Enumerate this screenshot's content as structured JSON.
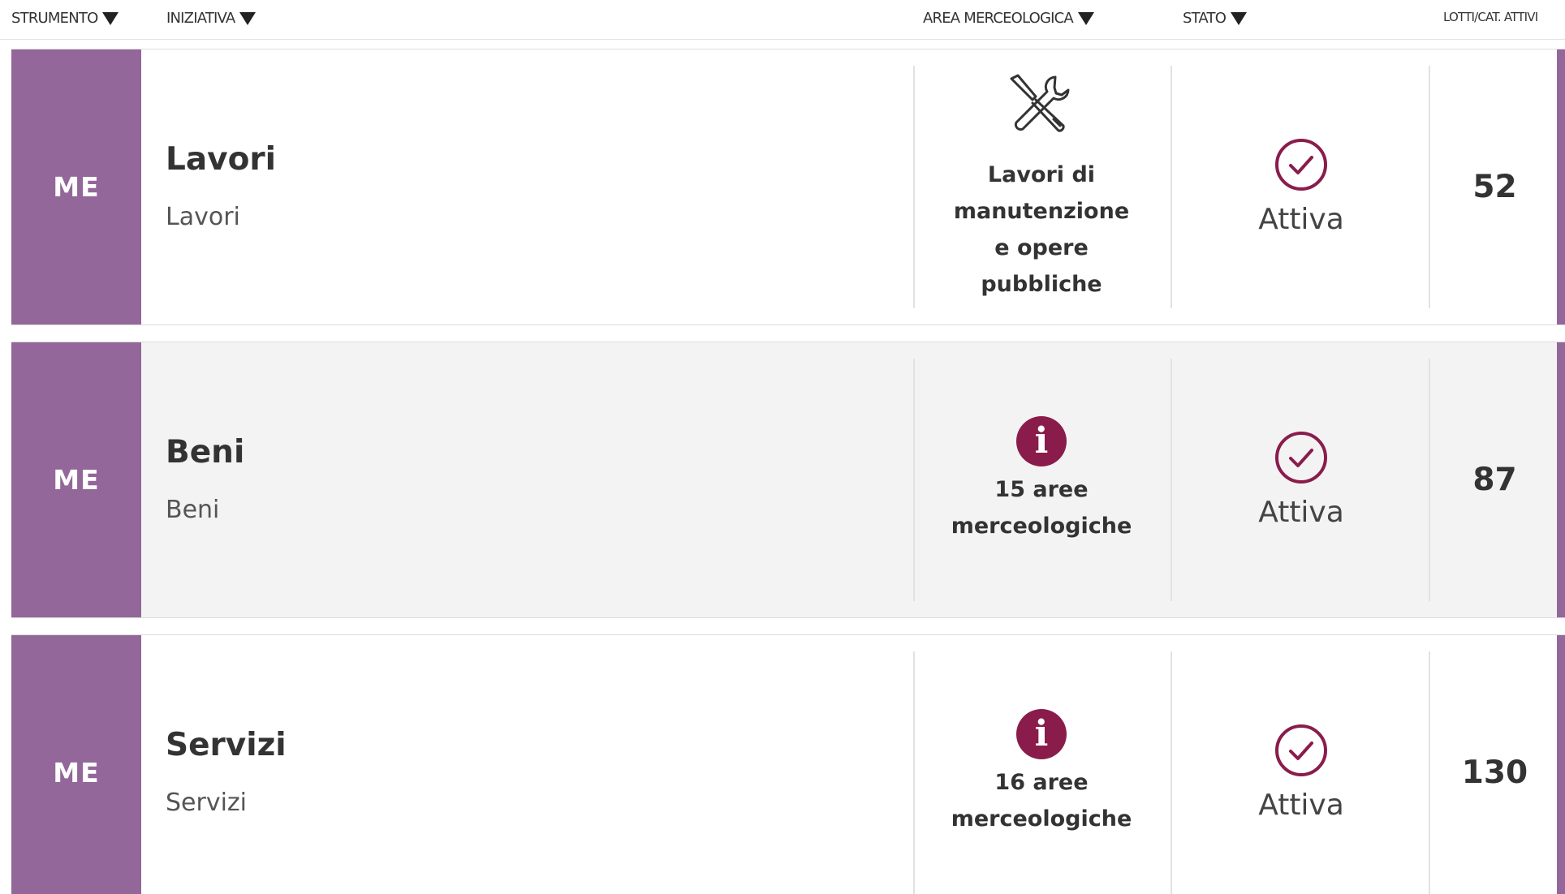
{
  "header": {
    "strumento": "STRUMENTO",
    "iniziativa": "INIZIATIVA",
    "area": "AREA MERCEOLOGICA",
    "stato": "STATO",
    "lotti": "LOTTI/CAT. ATTIVI"
  },
  "rows": [
    {
      "strumento": "ME",
      "title": "Lavori",
      "subtitle": "Lavori",
      "area_icon": "tools-icon",
      "area_text": "Lavori di manutenzione e opere pubbliche",
      "stato": "Attiva",
      "lotti": "52"
    },
    {
      "strumento": "ME",
      "title": "Beni",
      "subtitle": "Beni",
      "area_icon": "info-icon",
      "info_glyph": "i",
      "area_text": "15 aree merceologiche",
      "stato": "Attiva",
      "lotti": "87"
    },
    {
      "strumento": "ME",
      "title": "Servizi",
      "subtitle": "Servizi",
      "area_icon": "info-icon",
      "info_glyph": "i",
      "area_text": "16 aree merceologiche",
      "stato": "Attiva",
      "lotti": "130"
    }
  ],
  "colors": {
    "tool_bg": "#936799",
    "info_bg": "#8a1c4c",
    "check_color": "#8a1c4c",
    "alt_row_bg": "#f3f3f3"
  }
}
